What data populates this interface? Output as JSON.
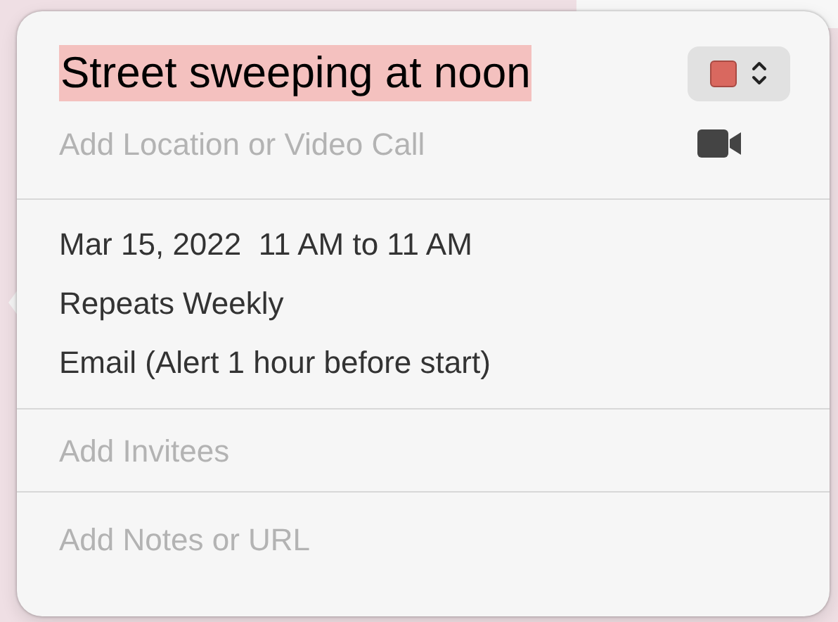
{
  "event": {
    "title": "Street sweeping at noon",
    "color": "#d9685f"
  },
  "location": {
    "placeholder": "Add Location or Video Call"
  },
  "details": [
    "Mar 15, 2022  11 AM to 11 AM",
    "Repeats Weekly",
    "Email (Alert 1 hour before start)"
  ],
  "invitees": {
    "placeholder": "Add Invitees"
  },
  "notes": {
    "placeholder": "Add Notes or URL"
  }
}
